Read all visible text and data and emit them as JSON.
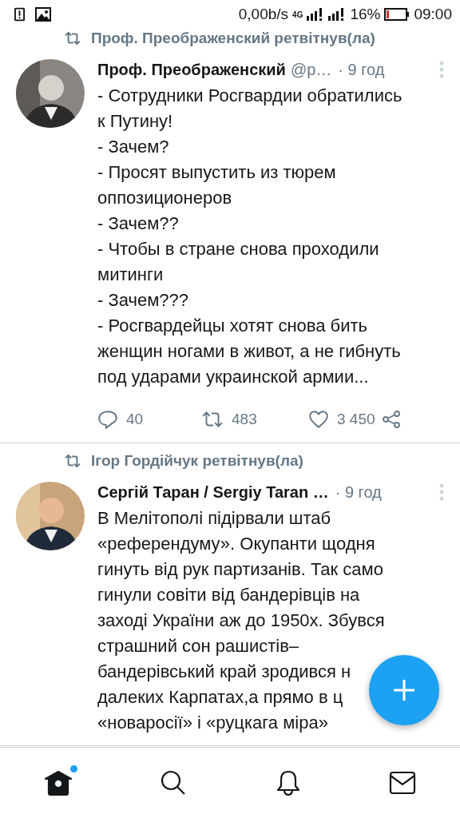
{
  "status_bar": {
    "speed": "0,00b/s",
    "network": "4G",
    "battery": "16%",
    "time": "09:00"
  },
  "tweets": [
    {
      "retweeted_by": "Проф. Преображенский ретвітнув(ла)",
      "name": "Проф. Преображенский",
      "handle": "@р…",
      "time": "· 9 год",
      "lines": [
        "- Сотрудники Росгвардии обратились",
        "к Путину!",
        "- Зачем?",
        "- Просят выпустить из тюрем",
        "оппозиционеров",
        "- Зачем??",
        "- Чтобы в стране снова проходили",
        "митинги",
        "- Зачем???",
        "- Росгвардейцы хотят снова бить",
        "женщин ногами в живот, а не гибнуть",
        "под ударами украинской армии..."
      ],
      "replies": "40",
      "retweets": "483",
      "likes": "3 450"
    },
    {
      "retweeted_by": "Ігор Гордійчук ретвітнув(ла)",
      "name": "Сергій Таран / Sergiy Taran …",
      "time": "· 9 год",
      "lines": [
        "В Мелітополі підірвали штаб",
        "«референдуму». Окупанти щодня",
        "гинуть від рук партизанів. Так само",
        "гинули совіти від бандерівців на",
        "заході України аж до 1950х. Збувся",
        "страшний сон рашистів–",
        "бандерівський край зродився н",
        "далеких Карпатах,а прямо в ц",
        "«новаросії» і «руцкага міра»"
      ]
    }
  ],
  "nav": [
    {
      "kind": "home",
      "selected": true,
      "has_new": true
    },
    {
      "kind": "search",
      "selected": false,
      "has_new": false
    },
    {
      "kind": "bell",
      "selected": false,
      "has_new": false
    },
    {
      "kind": "mail",
      "selected": false,
      "has_new": false
    }
  ]
}
